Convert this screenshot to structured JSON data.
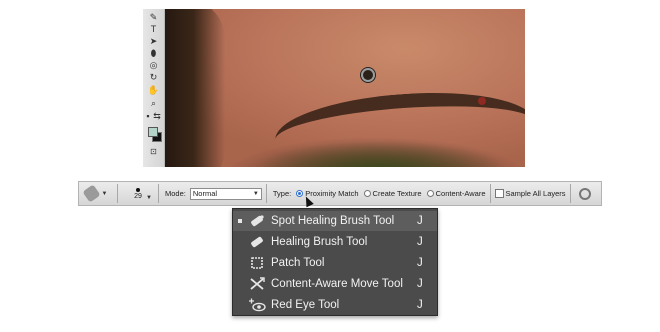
{
  "toolbar": {
    "tools": [
      {
        "name": "pen-tool-icon",
        "glyph": "✎"
      },
      {
        "name": "type-tool-icon",
        "glyph": "T"
      },
      {
        "name": "path-selection-tool-icon",
        "glyph": "➤"
      },
      {
        "name": "ellipse-tool-icon",
        "glyph": "⬮"
      },
      {
        "name": "3d-rotate-tool-icon",
        "glyph": "◎"
      },
      {
        "name": "3d-orbit-tool-icon",
        "glyph": "↻"
      },
      {
        "name": "hand-tool-icon",
        "glyph": "✋"
      },
      {
        "name": "zoom-tool-icon",
        "glyph": "⌕"
      },
      {
        "name": "default-colors-icon",
        "glyph": "▪"
      },
      {
        "name": "swap-colors-icon",
        "glyph": "⇆"
      }
    ],
    "quick_mask_glyph": "⊡",
    "foreground_color": "#b3d4c8",
    "background_color": "#111111"
  },
  "options_bar": {
    "brush_size": "29",
    "mode_label": "Mode:",
    "mode_value": "Normal",
    "type_label": "Type:",
    "type_options": [
      {
        "label": "Proximity Match",
        "selected": true
      },
      {
        "label": "Create Texture",
        "selected": false
      },
      {
        "label": "Content-Aware",
        "selected": false
      }
    ],
    "sample_all_layers_label": "Sample All Layers",
    "sample_all_layers_checked": false
  },
  "menu": {
    "items": [
      {
        "label": "Spot Healing Brush Tool",
        "shortcut": "J",
        "icon": "spot-healing-brush-icon",
        "selected": true
      },
      {
        "label": "Healing Brush Tool",
        "shortcut": "J",
        "icon": "healing-brush-icon",
        "selected": false
      },
      {
        "label": "Patch Tool",
        "shortcut": "J",
        "icon": "patch-tool-icon",
        "selected": false
      },
      {
        "label": "Content-Aware Move Tool",
        "shortcut": "J",
        "icon": "content-aware-move-icon",
        "selected": false
      },
      {
        "label": "Red Eye Tool",
        "shortcut": "J",
        "icon": "red-eye-icon",
        "selected": false
      }
    ]
  },
  "colors": {
    "menu_bg": "#4b4b4b",
    "menu_selected": "#5d5d5d",
    "radio_accent": "#2f6fd0"
  }
}
